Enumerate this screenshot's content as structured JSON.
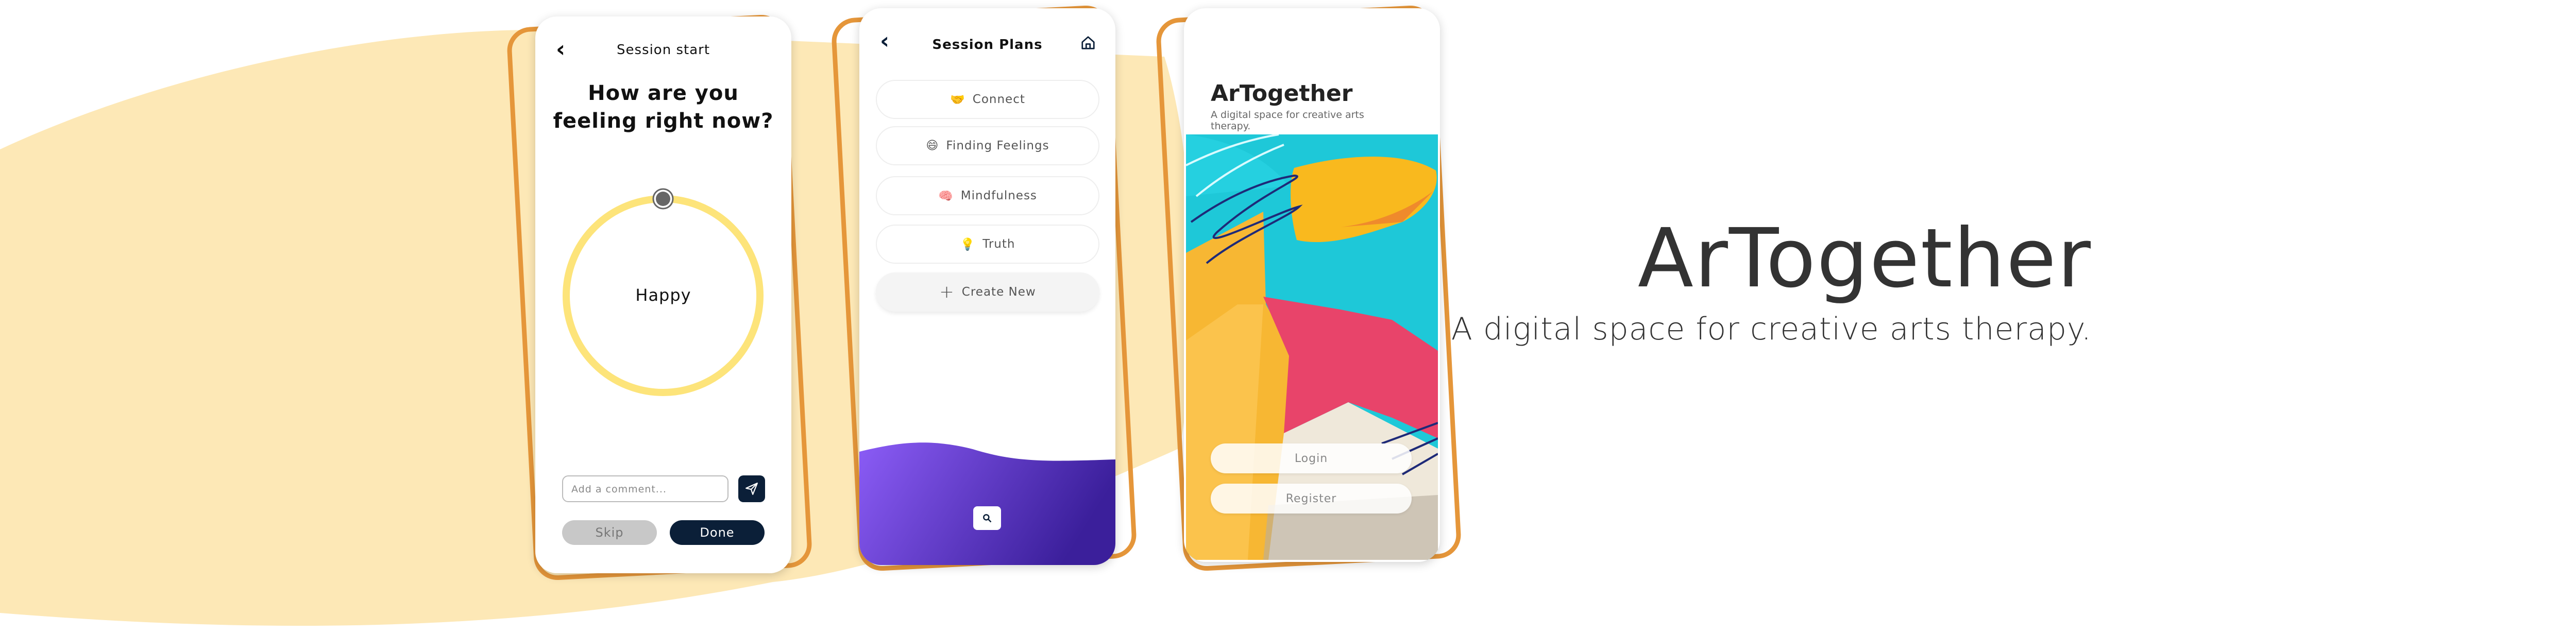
{
  "colors": {
    "blob": "#FDE8B6",
    "frame": "#E5963A",
    "navy": "#0b1f38",
    "ring": "#FDE47A",
    "purple_start": "#8B5CF6",
    "purple_end": "#3B1F9B"
  },
  "screen1": {
    "back_icon": "chevron-left",
    "title": "Session start",
    "heading_line1": "How are you",
    "heading_line2": "feeling right now?",
    "mood": "Happy",
    "comment_placeholder": "Add a comment...",
    "send_icon": "paper-plane",
    "skip": "Skip",
    "done": "Done"
  },
  "screen2": {
    "back_icon": "chevron-left",
    "title": "Session Plans",
    "home_icon": "home",
    "plans": [
      {
        "emoji": "🤝",
        "label": "Connect"
      },
      {
        "emoji": "😄",
        "label": "Finding Feelings"
      },
      {
        "emoji": "🧠",
        "label": "Mindfulness"
      },
      {
        "emoji": "💡",
        "label": "Truth"
      }
    ],
    "create_icon": "+",
    "create_label": "Create New",
    "search_icon": "search"
  },
  "screen3": {
    "app_name": "ArTogether",
    "tagline": "A digital space for creative arts therapy.",
    "login": "Login",
    "register": "Register"
  },
  "hero": {
    "title": "ArTogether",
    "subtitle": "A digital space for creative arts therapy."
  }
}
